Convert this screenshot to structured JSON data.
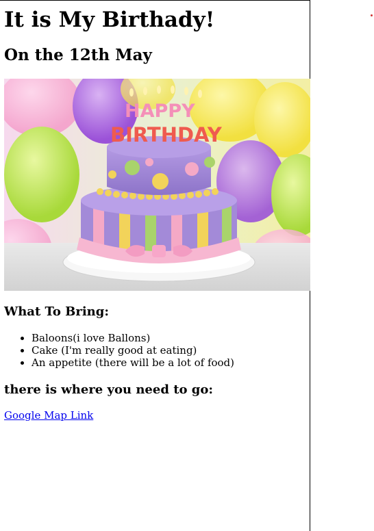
{
  "title": "It is My Birthady!",
  "subtitle": "On the 12th May",
  "image": {
    "topper_line1": "HAPPY",
    "topper_line2": "BIRTHDAY"
  },
  "bring": {
    "heading": "What To Bring:",
    "items": [
      "Baloons(i love Ballons)",
      "Cake (I'm really good at eating)",
      "An appetite (there will be a lot of food)"
    ]
  },
  "directions": {
    "heading": "there is where you need to go:",
    "link_text": "Google Map Link"
  },
  "colors": {
    "link": "#0000ee",
    "cake_purple": "#a38ad8",
    "frosting_pink": "#f5a9c6",
    "accent_yellow": "#f2d35a",
    "accent_green": "#a9d36b"
  }
}
